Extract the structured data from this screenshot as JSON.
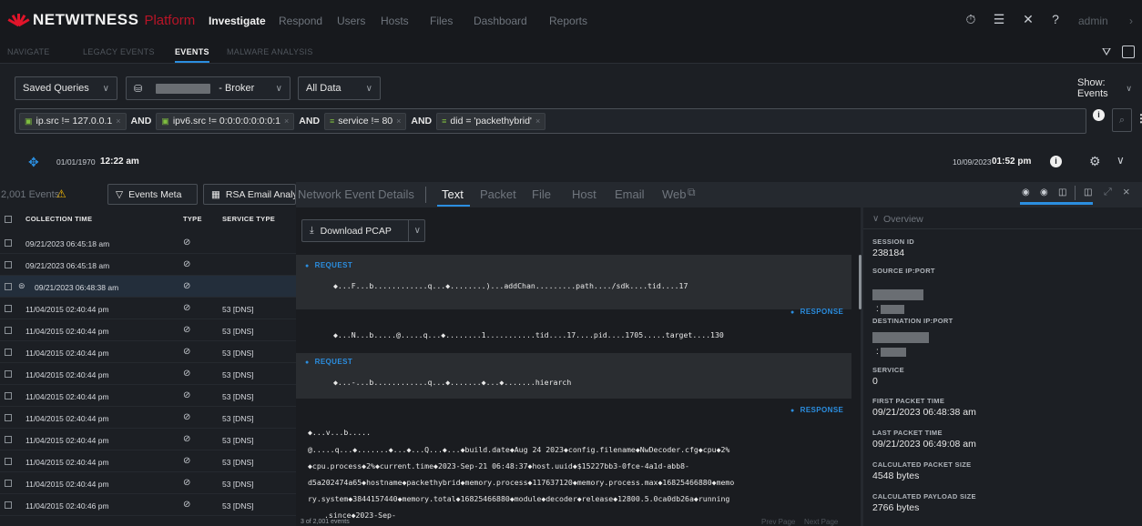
{
  "app": {
    "brand": "NETWITNESS",
    "platform": "Platform"
  },
  "topnav": [
    "Investigate",
    "Respond",
    "Users",
    "Hosts",
    "Files",
    "Dashboard",
    "Reports"
  ],
  "topnav_active": "Investigate",
  "user": "admin",
  "subnav": [
    "NAVIGATE",
    "LEGACY EVENTS",
    "EVENTS",
    "MALWARE ANALYSIS"
  ],
  "query": {
    "saved_queries": "Saved Queries",
    "broker": "- Broker",
    "all_data": "All Data",
    "show_events": "Show: Events",
    "filters": [
      "ip.src != 127.0.0.1",
      "ipv6.src != 0:0:0:0:0:0:0:1",
      "service != 80",
      "did = 'packethybrid'"
    ],
    "op": "AND"
  },
  "time": {
    "start_date": "01/01/1970",
    "start_time": "12:22 am",
    "end_date": "10/09/2023",
    "end_time": "01:52 pm"
  },
  "events": {
    "count": "2,001 Events",
    "meta_btn": "Events Meta",
    "rsa_btn": "RSA Email Analysis",
    "columns": [
      "COLLECTION TIME",
      "TYPE",
      "SERVICE TYPE"
    ],
    "rows": [
      {
        "time": "09/21/2023 06:45:18 am",
        "service": ""
      },
      {
        "time": "09/21/2023 06:45:18 am",
        "service": ""
      },
      {
        "time": "09/21/2023 06:48:38 am",
        "service": ""
      },
      {
        "time": "11/04/2015 02:40:44 pm",
        "service": "53 [DNS]"
      },
      {
        "time": "11/04/2015 02:40:44 pm",
        "service": "53 [DNS]"
      },
      {
        "time": "11/04/2015 02:40:44 pm",
        "service": "53 [DNS]"
      },
      {
        "time": "11/04/2015 02:40:44 pm",
        "service": "53 [DNS]"
      },
      {
        "time": "11/04/2015 02:40:44 pm",
        "service": "53 [DNS]"
      },
      {
        "time": "11/04/2015 02:40:44 pm",
        "service": "53 [DNS]"
      },
      {
        "time": "11/04/2015 02:40:44 pm",
        "service": "53 [DNS]"
      },
      {
        "time": "11/04/2015 02:40:44 pm",
        "service": "53 [DNS]"
      },
      {
        "time": "11/04/2015 02:40:44 pm",
        "service": "53 [DNS]"
      },
      {
        "time": "11/04/2015 02:40:46 pm",
        "service": "53 [DNS]"
      }
    ],
    "footer": "3 of 2,001 events"
  },
  "detail": {
    "tabs": [
      "Network Event Details",
      "Text",
      "Packet",
      "File",
      "Host",
      "Email",
      "Web"
    ],
    "active_tab": "Text",
    "download": "Download PCAP",
    "request_label": "REQUEST",
    "response_label": "RESPONSE",
    "lines": {
      "req1": "◆...F...b............q...◆........)...addChan.........path..../sdk....tid....17",
      "resp1": "◆...N...b.....@.....q...◆........1...........tid....17....pid....1705.....target....130",
      "req2": "◆...-...b............q...◆.......◆...◆.......hierarch",
      "resp2a": "◆...v...b.....",
      "resp2b": "@.....q...◆.......◆...◆...Q...◆...◆build.date◆Aug 24 2023◆config.filename◆NwDecoder.cfg◆cpu◆2%",
      "resp2c": "◆cpu.process◆2%◆current.time◆2023-Sep-21 06:48:37◆host.uuid◆$15227bb3-0fce-4a1d-abb8-",
      "resp2d": "d5a202474a65◆hostname◆packethybrid◆memory.process◆117637120◆memory.process.max◆16825466880◆memo",
      "resp2e": "ry.system◆3844157440◆memory.total◆16825466880◆module◆decoder◆release◆12800.5.0ca0db26a◆running",
      "resp2f": ".since◆2023-Sep-"
    },
    "pager": {
      "prev": "Prev Page",
      "next": "Next Page"
    }
  },
  "overview": {
    "title": "Overview",
    "fields": [
      {
        "label": "SESSION ID",
        "value": "238184"
      },
      {
        "label": "SOURCE IP:PORT",
        "value": ""
      },
      {
        "label": "DESTINATION IP:PORT",
        "value": ""
      },
      {
        "label": "SERVICE",
        "value": "0"
      },
      {
        "label": "FIRST PACKET TIME",
        "value": "09/21/2023 06:48:38 am"
      },
      {
        "label": "LAST PACKET TIME",
        "value": "09/21/2023 06:49:08 am"
      },
      {
        "label": "CALCULATED PACKET SIZE",
        "value": "4548 bytes"
      },
      {
        "label": "CALCULATED PAYLOAD SIZE",
        "value": "2766 bytes"
      }
    ]
  },
  "colors": {
    "accent": "#2b8ee0",
    "brand": "#e1142a",
    "warning": "#f2b705"
  }
}
